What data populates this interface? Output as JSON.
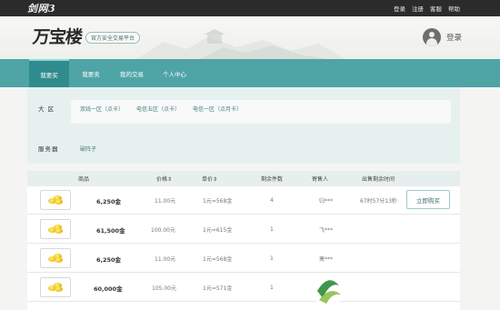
{
  "topbar": {
    "game_logo": "剑网3",
    "links": [
      "登录",
      "注册",
      "客服",
      "帮助"
    ]
  },
  "header": {
    "brand": "万宝楼",
    "subtitle": "官方安全交易平台",
    "login_label": "登录"
  },
  "nav": {
    "items": [
      "我要买",
      "我要卖",
      "我的交易",
      "个人中心"
    ],
    "active_index": 0
  },
  "filter": {
    "region_label": "大 区",
    "regions": [
      "双线一区（点卡）",
      "电信五区（点卡）",
      "电信一区（点月卡）"
    ],
    "server_label": "服务器",
    "server_value": "破阵子"
  },
  "table": {
    "headers": [
      "商品",
      "价格⇕",
      "单价⇕",
      "剩余件数",
      "寄售人",
      "出售剩余时间"
    ],
    "rows": [
      {
        "amount": "6,250金",
        "price": "11.00元",
        "unit": "1元=568金",
        "count": "4",
        "seller": "归***",
        "time": "67时57分13秒",
        "button": "立即购买"
      },
      {
        "amount": "61,500金",
        "price": "100.00元",
        "unit": "1元=615金",
        "count": "1",
        "seller": "飞***",
        "time": "",
        "button": ""
      },
      {
        "amount": "6,250金",
        "price": "11.00元",
        "unit": "1元=568金",
        "count": "1",
        "seller": "萧***",
        "time": "",
        "button": ""
      },
      {
        "amount": "60,000金",
        "price": "105.00元",
        "unit": "1元=571金",
        "count": "1",
        "seller": "",
        "time": "",
        "button": ""
      }
    ]
  },
  "colors": {
    "nav_bg": "#4fa4a6",
    "nav_active": "#2f8b8d",
    "topbar_bg": "#2b2b2b",
    "accent_text": "#3d6e6e"
  }
}
